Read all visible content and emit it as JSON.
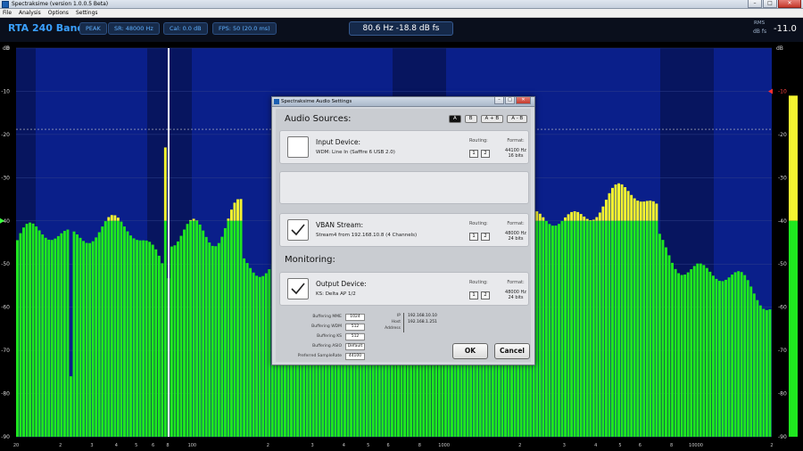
{
  "window": {
    "title": "Spectraksime (version 1.0.0.5 Beta)"
  },
  "menu": {
    "items": [
      "File",
      "Analysis",
      "Options",
      "Settings"
    ]
  },
  "infobar": {
    "rta_title": "RTA 240 Bands",
    "peak": "PEAK",
    "sr": "SR: 48000 Hz",
    "cal": "Cal:  0.0 dB",
    "fps": "FPS: 50  (20.0 ms)",
    "readout": "80.6 Hz   -18.8 dB fs",
    "rms_label": "RMS",
    "rms_unit": "dB fs",
    "rms_value": "-11.0"
  },
  "spectrum": {
    "db_unit": "dB",
    "y_labels": [
      "0",
      "-10",
      "-20",
      "-30",
      "-40",
      "-50",
      "-60",
      "-70",
      "-80",
      "-90"
    ],
    "right_labels": [
      "-10",
      "-20",
      "-30",
      "-40",
      "-50",
      "-60",
      "-70",
      "-80",
      "-90"
    ],
    "x_labels": [
      "20",
      "2",
      "3",
      "4",
      "5",
      "6",
      "8",
      "100",
      "2",
      "3",
      "4",
      "5",
      "6",
      "8",
      "1000",
      "2",
      "3",
      "4",
      "5",
      "6",
      "8",
      "10000",
      "2"
    ],
    "colors": {
      "bar_green": "#1fe81f",
      "bar_yellow": "#f5f530",
      "bg_blue": "#0a1f8a",
      "bg_dark": "#06114d"
    },
    "rms_meter_level_db": -11.0,
    "peak_threshold_db": -40,
    "cursor_freq_hz": 80.6
  },
  "dialog": {
    "title": "Spectraksime Audio Settings",
    "audio_sources_heading": "Audio Sources:",
    "source_buttons": [
      "A",
      "B",
      "A + B",
      "A - B"
    ],
    "input_device": {
      "title": "Input Device:",
      "device": "WDM: Line In (Saffire 6 USB 2.0)",
      "routing_label": "Routing:",
      "routing_buttons": [
        "1",
        "2"
      ],
      "format_label": "Format:",
      "format_hz": "44100 Hz",
      "format_bits": "16 bits"
    },
    "vban": {
      "title": "VBAN Stream:",
      "device": "Stream4 from 192.168.10.8 (4 Channels)",
      "routing_label": "Routing:",
      "routing_buttons": [
        "1",
        "2"
      ],
      "format_label": "Format:",
      "format_hz": "48000 Hz",
      "format_bits": "24 bits"
    },
    "monitoring_heading": "Monitoring:",
    "output_device": {
      "title": "Output Device:",
      "device": "KS: Delta AP 1/2",
      "routing_label": "Routing:",
      "routing_buttons": [
        "1",
        "2"
      ],
      "format_label": "Format:",
      "format_hz": "48000 Hz",
      "format_bits": "24 bits"
    },
    "buffering": {
      "mme_label": "Buffering MME",
      "mme_value": "1024",
      "wdm_label": "Buffering WDM",
      "wdm_value": "512",
      "ks_label": "Buffering KS",
      "ks_value": "512",
      "asio_label": "Buffering ASIO",
      "asio_value": "Default",
      "sr_label": "Preferred SampleRate",
      "sr_value": "44100"
    },
    "network": {
      "ip_label": "IP",
      "ip_value": "192.168.10.10",
      "host_label": "Host",
      "host_value": "192.168.1.251",
      "address_label": "Address"
    },
    "ok_label": "OK",
    "cancel_label": "Cancel"
  }
}
